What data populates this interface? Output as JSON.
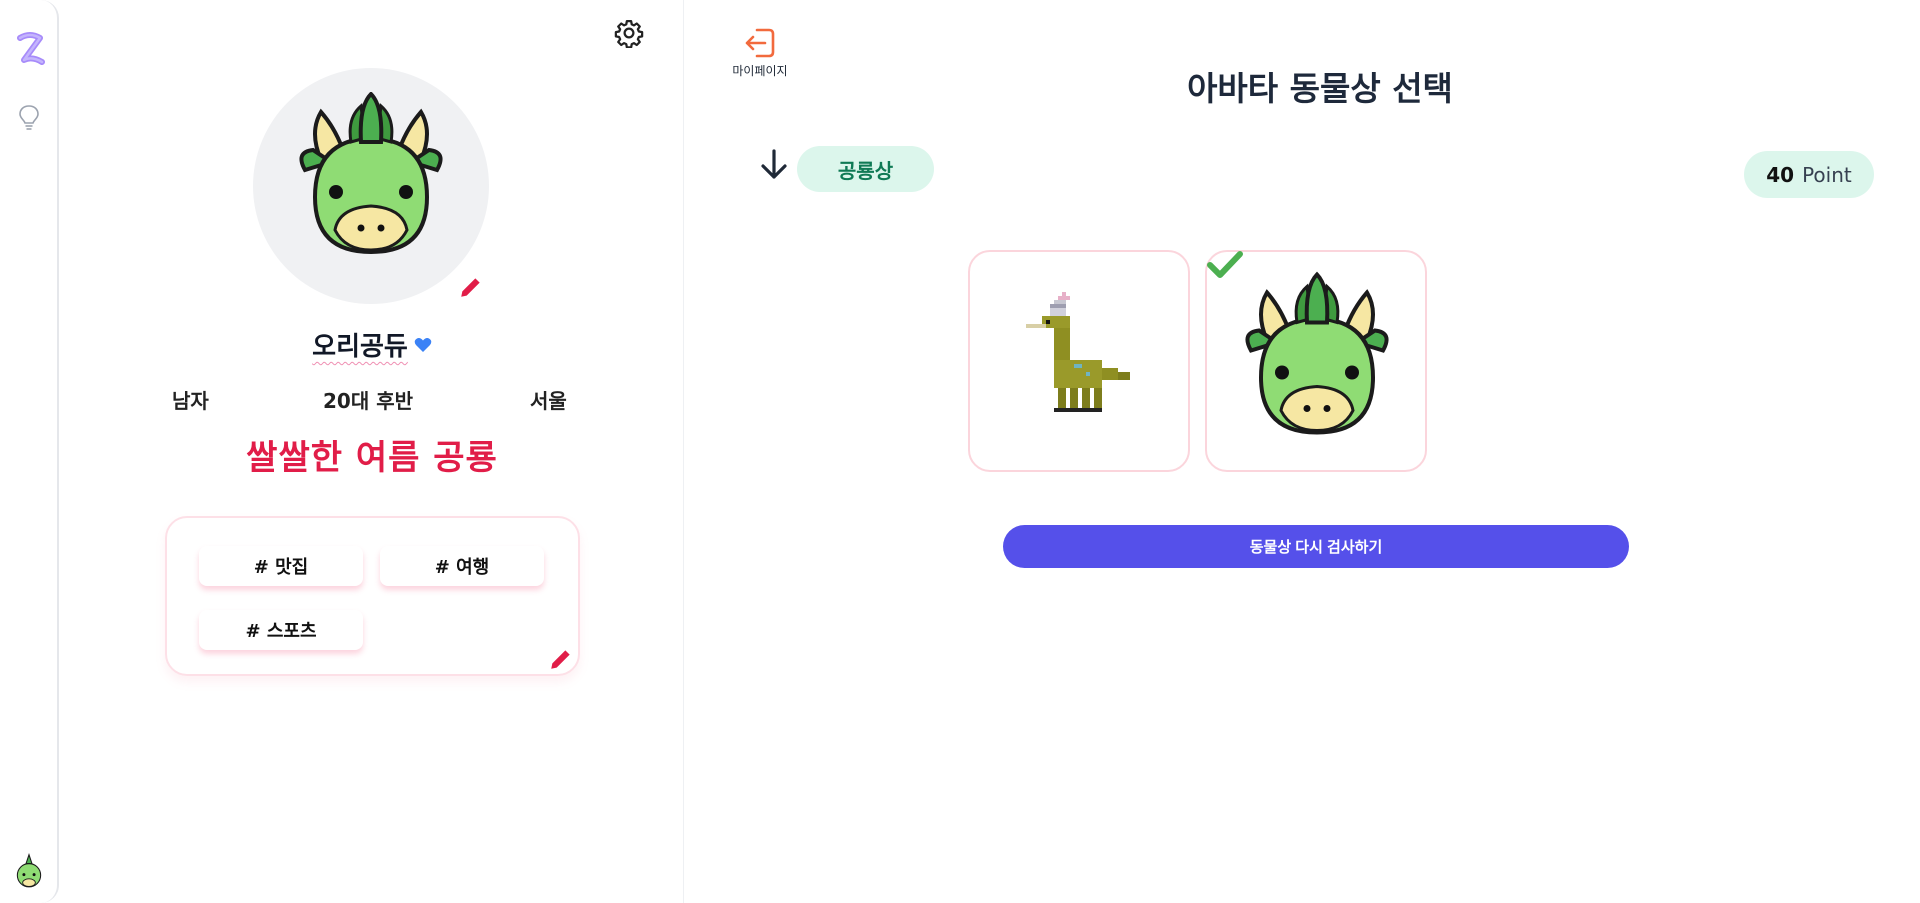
{
  "rail": {
    "logo_icon": "z-logo-icon",
    "bulb_icon": "lightbulb-icon",
    "avatar_icon": "dragon-mini-avatar"
  },
  "profile": {
    "settings_icon": "gear-icon",
    "nickname": "오리공듀",
    "verified_icon": "heart-icon",
    "gender": "남자",
    "age": "20대 후반",
    "city": "서울",
    "title": "쌀쌀한 여름 공룡",
    "tags": [
      "# 맛집",
      "# 여행",
      "# 스포츠"
    ]
  },
  "main": {
    "mypage_label": "마이페이지",
    "title": "아바타 동물상 선택",
    "animal_type": "공룡상",
    "points_value": "40",
    "points_unit": "Point",
    "avatars": [
      {
        "name": "pixel-dinosaur",
        "selected": false
      },
      {
        "name": "green-dragon",
        "selected": true
      }
    ],
    "retest_label": "동물상 다시 검사하기"
  },
  "colors": {
    "accent_red": "#e11d48",
    "primary_button": "#5550ea",
    "pill_bg": "#dcf6ec",
    "pill_text": "#0f7a55",
    "card_border": "#fbd5dc",
    "check_green": "#4caf50"
  }
}
